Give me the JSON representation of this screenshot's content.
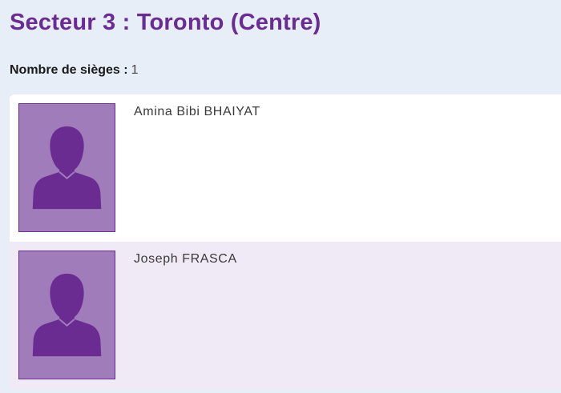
{
  "page": {
    "title": "Secteur 3 : Toronto (Centre)"
  },
  "seats": {
    "label": "Nombre de sièges",
    "separator": " :",
    "value": "1"
  },
  "candidates": [
    {
      "name": "Amina Bibi BHAIYAT",
      "photo_icon": "user-silhouette-icon"
    },
    {
      "name": "Joseph FRASCA",
      "photo_icon": "user-silhouette-icon"
    }
  ],
  "colors": {
    "title": "#6a2c91",
    "page_background": "#e8eef8",
    "card_odd": "#ffffff",
    "card_even": "#efeaf6",
    "photo_background": "#a07cbb",
    "silhouette": "#6a2c91"
  }
}
